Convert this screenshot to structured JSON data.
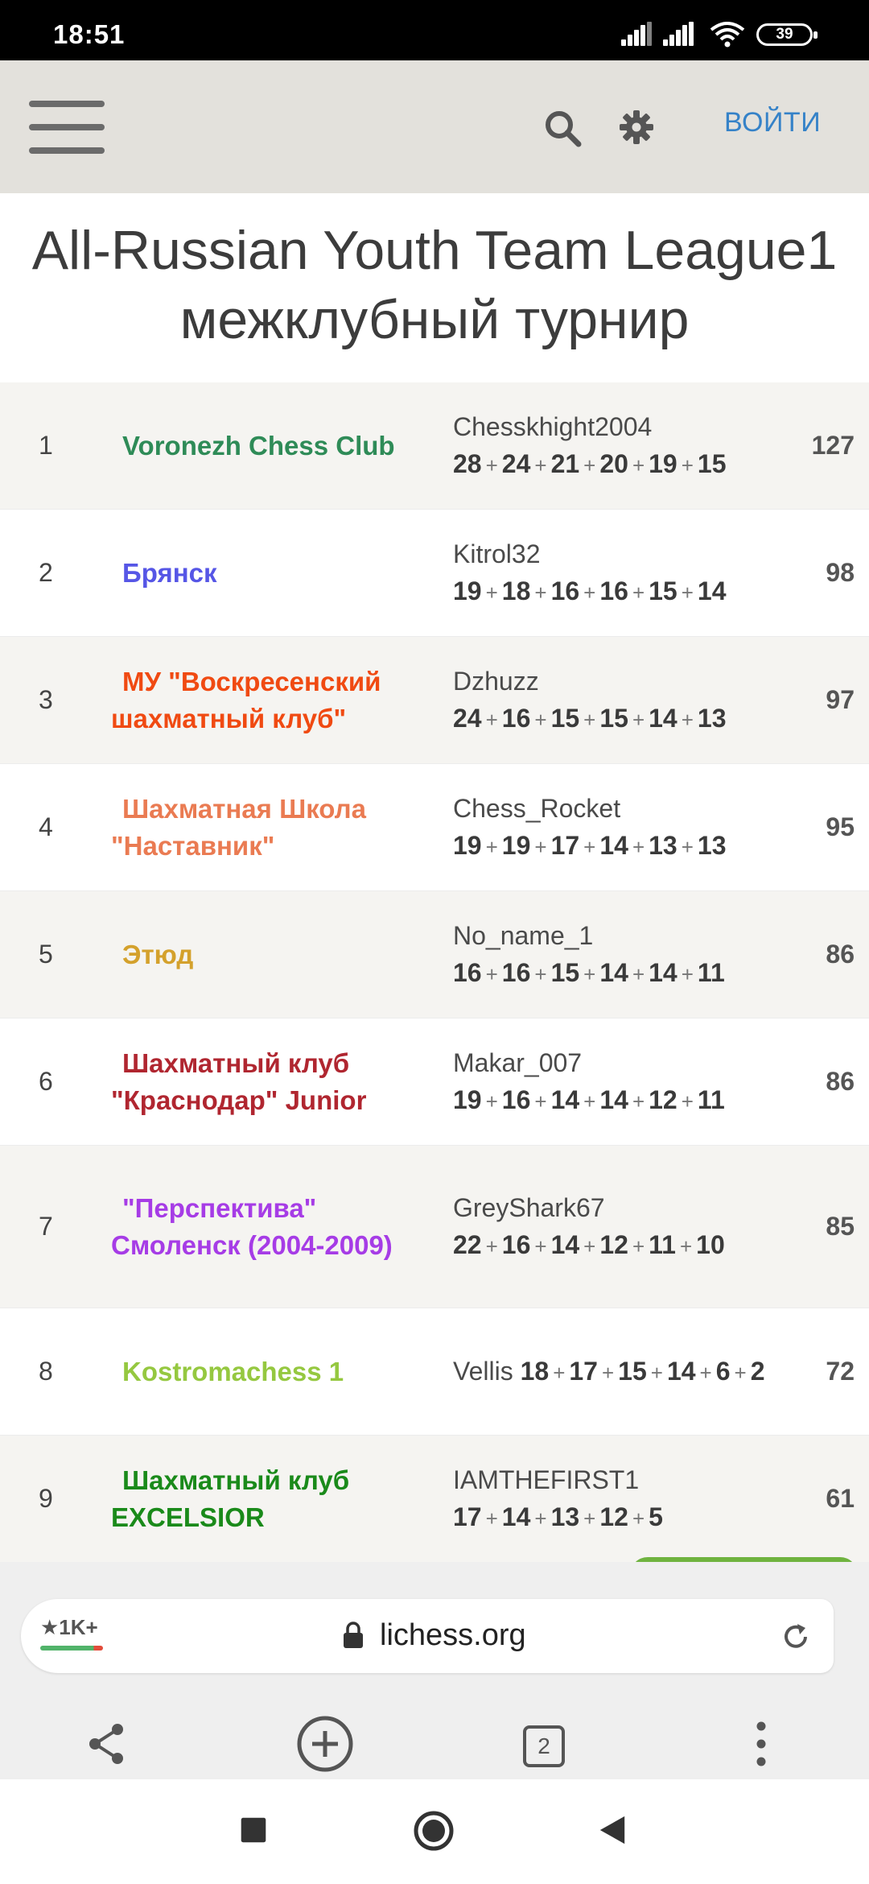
{
  "status_bar": {
    "time": "18:51",
    "battery": "39",
    "icons": [
      "signal-icon",
      "signal-icon",
      "wifi-icon",
      "battery-icon"
    ]
  },
  "header": {
    "menu_icon": "hamburger-icon",
    "search_icon": "search-icon",
    "settings_icon": "gear-icon",
    "login_label": "ВОЙТИ"
  },
  "page": {
    "title": "All-Russian Youth Team League1 межклубный турнир"
  },
  "colors": {
    "header_bg": "#e3e1dc",
    "login_link": "#3582c8",
    "join_button": "#6fb33f"
  },
  "standings": [
    {
      "rank": "1",
      "team": "Voronezh Chess Club",
      "team_color": "#2e8b57",
      "player": "Chesskhight2004",
      "scores": [
        "28",
        "24",
        "21",
        "20",
        "19",
        "15"
      ],
      "total": "127"
    },
    {
      "rank": "2",
      "team": "Брянск",
      "team_color": "#5656e6",
      "player": "Kitrol32",
      "scores": [
        "19",
        "18",
        "16",
        "16",
        "15",
        "14"
      ],
      "total": "98"
    },
    {
      "rank": "3",
      "team": "МУ \"Воскресенский шахматный клуб\"",
      "team_color": "#f04a12",
      "player": "Dzhuzz",
      "scores": [
        "24",
        "16",
        "15",
        "15",
        "14",
        "13"
      ],
      "total": "97"
    },
    {
      "rank": "4",
      "team": "Шахматная Школа \"Наставник\"",
      "team_color": "#ea7b52",
      "player": "Chess_Rocket",
      "scores": [
        "19",
        "19",
        "17",
        "14",
        "13",
        "13"
      ],
      "total": "95"
    },
    {
      "rank": "5",
      "team": "Этюд",
      "team_color": "#d4a12c",
      "player": "No_name_1",
      "scores": [
        "16",
        "16",
        "15",
        "14",
        "14",
        "11"
      ],
      "total": "86"
    },
    {
      "rank": "6",
      "team": "Шахматный клуб \"Краснодар\" Junior",
      "team_color": "#b02630",
      "player": "Makar_007",
      "scores": [
        "19",
        "16",
        "14",
        "14",
        "12",
        "11"
      ],
      "total": "86"
    },
    {
      "rank": "7",
      "team": "\"Перспектива\" Смоленск (2004-2009)",
      "team_color": "#a63ce6",
      "player": "GreyShark67",
      "scores": [
        "22",
        "16",
        "14",
        "12",
        "11",
        "10"
      ],
      "total": "85"
    },
    {
      "rank": "8",
      "team": "Kostromachess 1",
      "team_color": "#95c840",
      "player": "Vellis",
      "scores": [
        "18",
        "17",
        "15",
        "14",
        "6",
        "2"
      ],
      "total": "72"
    },
    {
      "rank": "9",
      "team": "Шахматный клуб EXCELSIOR",
      "team_color": "#1a8a1a",
      "player": "IAMTHEFIRST1",
      "scores": [
        "17",
        "14",
        "13",
        "12",
        "5"
      ],
      "total": "61"
    }
  ],
  "browser": {
    "rating_badge": "★1K+",
    "url": "lichess.org",
    "tabs_count": "2",
    "nav_icons": [
      "share-icon",
      "new-tab-icon",
      "tabs-icon",
      "more-icon"
    ]
  },
  "android_nav": {
    "icons": [
      "recents-icon",
      "home-icon",
      "back-icon"
    ]
  }
}
